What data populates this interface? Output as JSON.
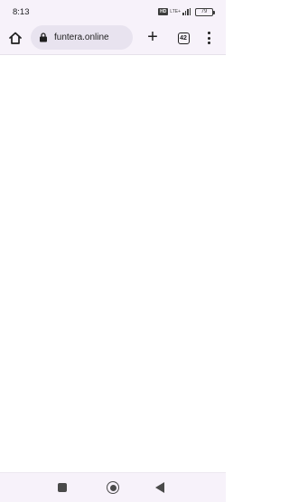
{
  "status_bar": {
    "time": "8:13",
    "sim_label": "HD",
    "network_label": "LTE+",
    "battery_level": "79",
    "icons": [
      "sim-hd-icon",
      "lte-plus-icon",
      "signal-icon",
      "battery-icon"
    ]
  },
  "browser": {
    "url": "funtera.online",
    "tab_count": "42",
    "new_tab_symbol": "+",
    "icons": {
      "home": "home-icon",
      "lock": "lock-icon",
      "new_tab": "plus-icon",
      "tabs": "tab-switcher-icon",
      "menu": "more-vert-icon"
    }
  },
  "nav_bar": {
    "icons": [
      "recents-square-icon",
      "home-circle-icon",
      "back-triangle-icon"
    ]
  },
  "colors": {
    "chrome_background": "#f7f2fa",
    "omnibox_background": "#e8e3ef",
    "content_background": "#ffffff",
    "icon_color": "#1f1f1f"
  }
}
